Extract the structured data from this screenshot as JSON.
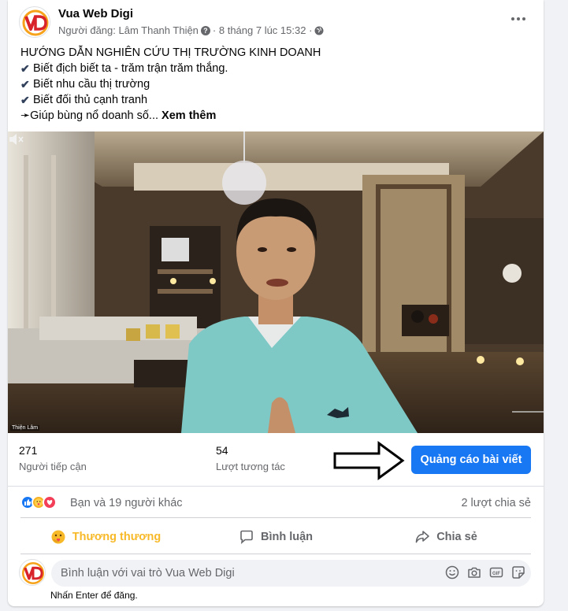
{
  "post": {
    "page_name": "Vua Web Digi",
    "meta": "Người đăng: Lâm Thanh Thiện",
    "meta_time": "· 8 tháng 7 lúc 15:32 ·",
    "title": "HƯỚNG DẪN NGHIÊN CỨU THỊ TRƯỜNG KINH DOANH",
    "bullets": [
      "Biết địch biết ta - trăm trận trăm thắng.",
      "Biết nhu cầu thị trường",
      "Biết đối thủ cạnh tranh"
    ],
    "last_line": "➛Giúp bùng nổ doanh số...",
    "see_more": "Xem thêm"
  },
  "video": {
    "caption": "Thiện Lâm"
  },
  "stats": {
    "reach_value": "271",
    "reach_label": "Người tiếp cận",
    "engagement_value": "54",
    "engagement_label": "Lượt tương tác",
    "promote_label": "Quảng cáo bài viết"
  },
  "reactions": {
    "summary": "Bạn và 19 người khác",
    "shares": "2 lượt chia sẻ"
  },
  "actions": {
    "react_label": "Thương thương",
    "comment_label": "Bình luận",
    "share_label": "Chia sẻ"
  },
  "comment": {
    "placeholder": "Bình luận với vai trò Vua Web Digi",
    "hint": "Nhấn Enter để đăng."
  },
  "colors": {
    "accent": "#1877f2",
    "react_active": "#f7b928",
    "muted": "#65676b"
  }
}
